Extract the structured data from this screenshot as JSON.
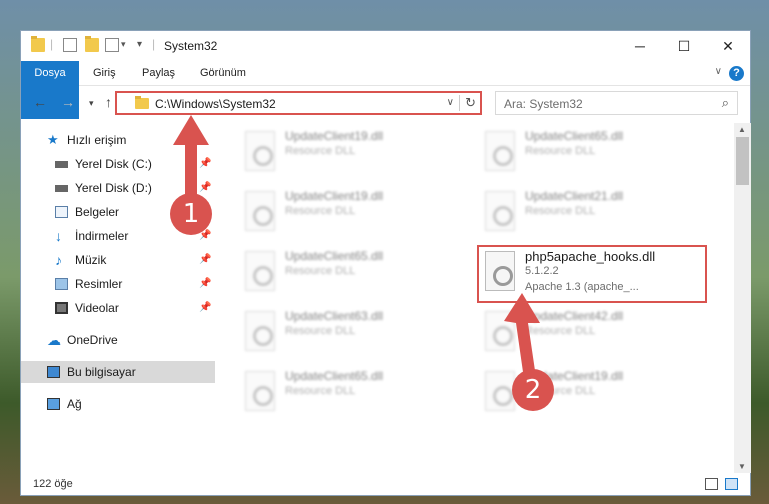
{
  "window": {
    "title": "System32"
  },
  "titlebar": {
    "minimize": "─",
    "maximize": "☐",
    "close": "✕",
    "dropdown": "▾",
    "checkmark_icon": "check-document-icon"
  },
  "ribbon": {
    "tabs": [
      "Dosya",
      "Giriş",
      "Paylaş",
      "Görünüm"
    ]
  },
  "navbar": {
    "back": "←",
    "forward": "→",
    "recent": "▾",
    "up": "↑",
    "address": "C:\\Windows\\System32",
    "search_placeholder": "Ara: System32"
  },
  "sidebar": {
    "items": [
      {
        "label": "Hızlı erişim",
        "icon": "star-icon",
        "pinned": false
      },
      {
        "label": "Yerel Disk (C:)",
        "icon": "drive-icon",
        "pinned": true
      },
      {
        "label": "Yerel Disk (D:)",
        "icon": "drive-icon",
        "pinned": true
      },
      {
        "label": "Belgeler",
        "icon": "documents-icon",
        "pinned": true
      },
      {
        "label": "İndirmeler",
        "icon": "download-icon",
        "pinned": true
      },
      {
        "label": "Müzik",
        "icon": "music-icon",
        "pinned": true
      },
      {
        "label": "Resimler",
        "icon": "pictures-icon",
        "pinned": true
      },
      {
        "label": "Videolar",
        "icon": "videos-icon",
        "pinned": true
      },
      {
        "label": "OneDrive",
        "icon": "cloud-icon",
        "pinned": false
      },
      {
        "label": "Bu bilgisayar",
        "icon": "computer-icon",
        "pinned": false
      },
      {
        "label": "Ağ",
        "icon": "network-icon",
        "pinned": false
      }
    ]
  },
  "files": [
    {
      "name": "UpdateClient19.dll",
      "type": "Resource DLL"
    },
    {
      "name": "UpdateClient65.dll",
      "type": "Resource DLL"
    },
    {
      "name": "UpdateClient19.dll",
      "type": "Resource DLL"
    },
    {
      "name": "UpdateClient21.dll",
      "type": "Resource DLL"
    },
    {
      "name": "UpdateClient65.dll",
      "type": "Resource DLL"
    },
    {
      "name": "php5apache_hooks.dll",
      "type": "5.1.2.2",
      "extra": "Apache 1.3 (apache_..."
    },
    {
      "name": "UpdateClient63.dll",
      "type": "Resource DLL"
    },
    {
      "name": "UpdateClient42.dll",
      "type": "Resource DLL"
    },
    {
      "name": "UpdateClient65.dll",
      "type": "Resource DLL"
    },
    {
      "name": "UpdateClient19.dll",
      "type": "Resource DLL"
    }
  ],
  "status": {
    "count": "122 öğe"
  },
  "callouts": {
    "one": "1",
    "two": "2"
  },
  "colors": {
    "accent": "#1979ca",
    "highlight": "#d9534f"
  }
}
